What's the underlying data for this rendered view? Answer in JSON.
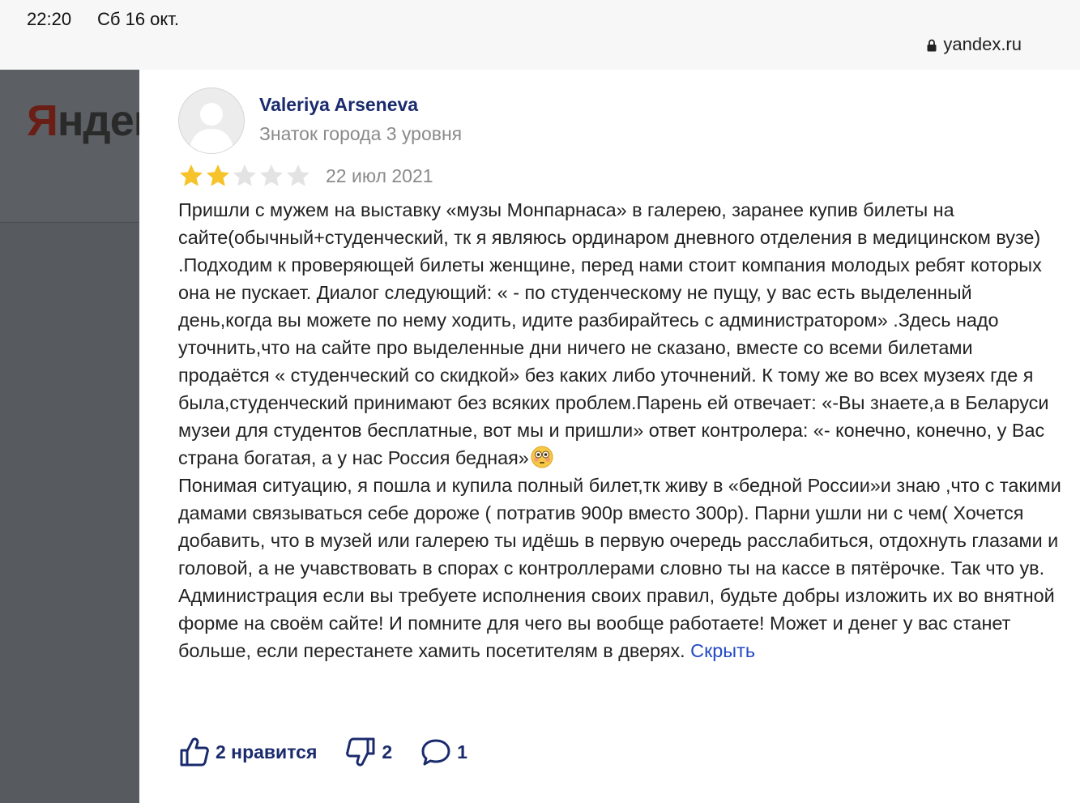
{
  "status_bar": {
    "time": "22:20",
    "date": "Сб 16 окт."
  },
  "browser": {
    "url": "yandex.ru"
  },
  "background": {
    "logo_dark": "Янде",
    "logo_red": "Я",
    "logo_rest": "ндек"
  },
  "review": {
    "author": "Valeriya Arseneva",
    "level": "Знаток города 3 уровня",
    "rating": 2,
    "rating_max": 5,
    "date": "22 июл 2021",
    "paragraph1": "Пришли с мужем на выставку «музы Монпарнаса» в галерею, заранее купив билеты на сайте(обычный+студенческий, тк я являюсь ординаром дневного отделения в медицинском вузе) .Подходим к проверяющей билеты женщине, перед нами стоит компания молодых ребят которых она не пускает. Диалог следующий: « - по студенческому не пущу, у вас есть выделенный день,когда вы можете по нему ходить, идите разбирайтесь с администратором» .Здесь надо уточнить,что на сайте про выделенные дни ничего не сказано, вместе со всеми билетами продаётся « студенческий со скидкой» без каких либо уточнений. К тому же во всех музеях где я была,студенческий принимают без всяких проблем.Парень ей отвечает: «-Вы знаете,а в Беларуси музеи для студентов бесплатные, вот мы и пришли» ответ контролера: «- конечно, конечно, у Вас страна богатая, а у нас Россия бедная»",
    "paragraph2": "Понимая ситуацию, я пошла и купила полный билет,тк живу в «бедной России»и знаю ,что с такими дамами связываться себе дороже ( потратив 900р вместо 300р). Парни ушли ни с чем( Хочется добавить, что в музей или галерею ты идёшь в первую очередь расслабиться, отдохнуть глазами и головой, а не учавствовать в спорах с контроллерами словно ты на кассе в пятёрочке. Так что ув. Администрация если вы требуете исполнения своих правил, будьте добры изложить их во внятной форме на своём сайте! И помните для чего вы вообще работаете! Может и денег у вас станет больше, если перестанете хамить посетителям в дверях. ",
    "hide_link": "Скрыть",
    "likes_label": "2 нравится",
    "dislikes": "2",
    "comments": "1"
  },
  "colors": {
    "star_filled": "#f6c42a",
    "star_empty": "#e3e3e3",
    "link": "#2249c4",
    "name": "#1a2b6d"
  },
  "icons": [
    "lock-icon",
    "avatar-silhouette-icon",
    "star-icon",
    "flushed-face-emoji",
    "thumbs-up-icon",
    "thumbs-down-icon",
    "comment-bubble-icon"
  ]
}
